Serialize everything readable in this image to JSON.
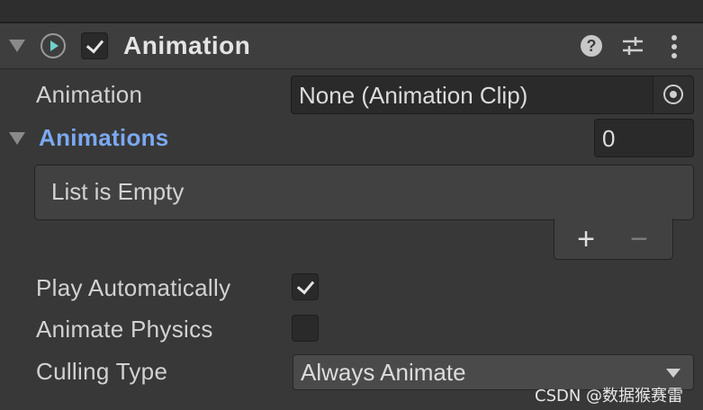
{
  "header": {
    "title": "Animation",
    "enabled": true,
    "icons": [
      "foldout-arrow-icon",
      "animation-component-icon",
      "help-icon",
      "presets-icon",
      "kebab-menu-icon"
    ]
  },
  "properties": {
    "animation_label": "Animation",
    "animation_value": "None (Animation Clip)",
    "animations_label": "Animations",
    "animations_size": "0",
    "list_empty_text": "List is Empty",
    "add_symbol": "+",
    "remove_symbol": "−",
    "play_automatically_label": "Play Automatically",
    "play_automatically_checked": true,
    "animate_physics_label": "Animate Physics",
    "animate_physics_checked": false,
    "culling_type_label": "Culling Type",
    "culling_type_value": "Always Animate"
  },
  "watermark": "CSDN @数据猴赛雷",
  "colors": {
    "panel_bg": "#383838",
    "header_bg": "#3e3e3e",
    "field_bg": "#2a2a2a",
    "highlight_label": "#7ba9f2",
    "play_icon": "#6fd1c8"
  }
}
